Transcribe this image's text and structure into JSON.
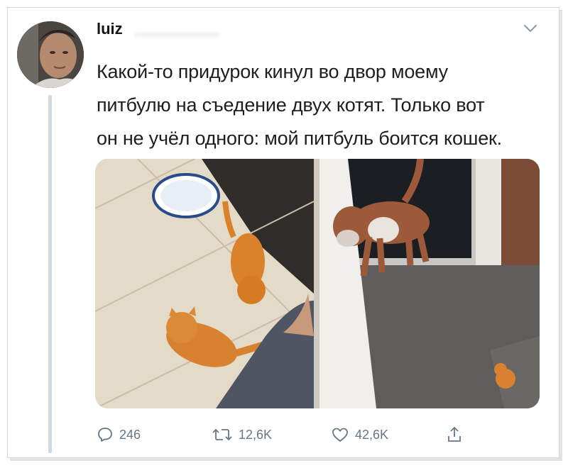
{
  "tweet": {
    "username": "luiz",
    "text_lines": [
      "Какой-то придурок кинул во двор моему",
      "питбулю на съедение двух котят. Только вот",
      "он не учёл одного: мой питбуль боится кошек."
    ],
    "photos": [
      "two-orange-kittens-on-tiles",
      "pitbull-and-kitten-in-yard"
    ],
    "actions": {
      "reply_count": "246",
      "retweet_count": "12,6K",
      "like_count": "42,6K"
    }
  },
  "icons": {
    "more": "chevron-down-icon",
    "reply": "reply-icon",
    "retweet": "retweet-icon",
    "like": "heart-icon",
    "share": "share-icon"
  },
  "colors": {
    "text": "#14171a",
    "secondary": "#657786",
    "thread_line": "#cfd9de"
  }
}
